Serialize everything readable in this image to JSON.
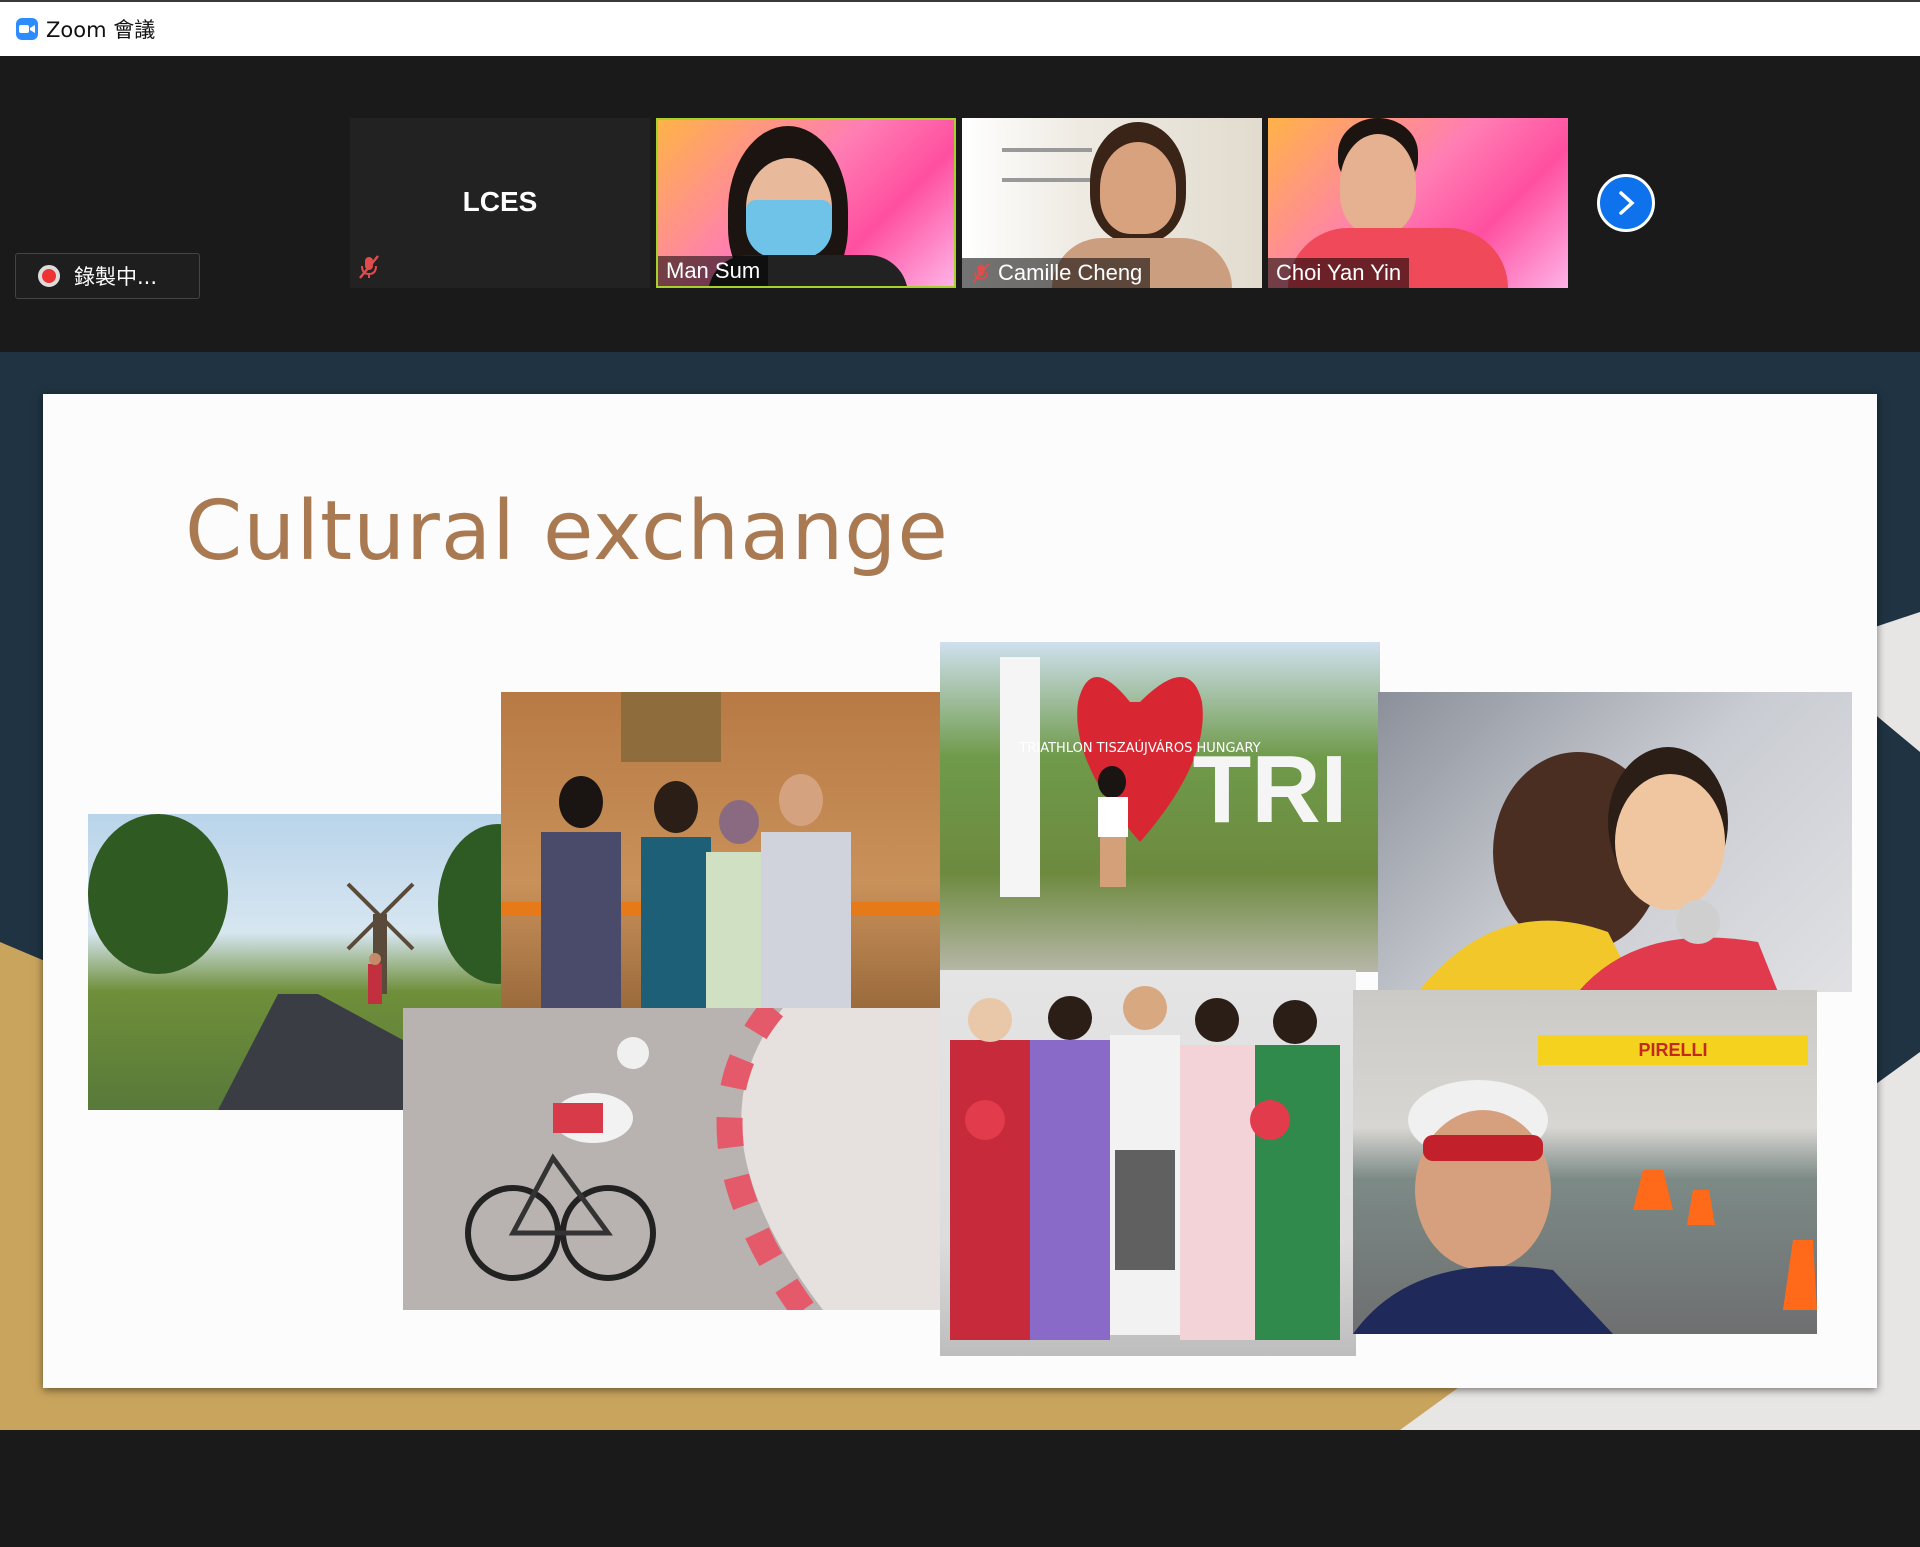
{
  "window": {
    "app_title": "Zoom 會議"
  },
  "participants": [
    {
      "name": "LCES",
      "muted": true,
      "video": false
    },
    {
      "name": "Man Sum",
      "muted": false,
      "video": true,
      "active_speaker": true
    },
    {
      "name": "Camille Cheng",
      "muted": true,
      "video": true
    },
    {
      "name": "Choi Yan Yin",
      "muted": false,
      "video": true
    }
  ],
  "recording": {
    "label": "錄製中..."
  },
  "slide": {
    "title": "Cultural exchange",
    "photo_text": {
      "heart_sign": "TRIATHLON TISZAÚJVÁROS HUNGARY",
      "tri_letters": "TRI",
      "banner": "PIRELLI"
    }
  },
  "colors": {
    "zoom_blue": "#2d8cff",
    "next_button": "#0e72ed",
    "active_speaker_border": "#a6d12a",
    "title_color": "#a97a52",
    "slide_bg": "#fdfcfd",
    "share_bg": "#1f3342",
    "gold_accent": "#c9a45c",
    "recording_dot": "#e33333"
  },
  "icons": [
    "zoom-logo-icon",
    "mic-muted-icon",
    "chevron-right-icon",
    "recording-dot-icon"
  ]
}
